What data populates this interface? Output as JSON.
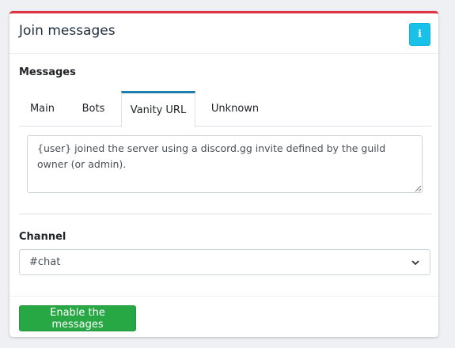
{
  "card": {
    "title": "Join messages",
    "accent_color": "#dc3545",
    "info_button": {
      "label": "i",
      "icon": "info-icon",
      "color": "#17c1e8"
    }
  },
  "messages": {
    "label": "Messages",
    "tabs": [
      {
        "label": "Main",
        "active": false
      },
      {
        "label": "Bots",
        "active": false
      },
      {
        "label": "Vanity URL",
        "active": true
      },
      {
        "label": "Unknown",
        "active": false
      }
    ],
    "text": "{user} joined the server using a discord.gg invite defined by the guild owner (or admin)."
  },
  "channel": {
    "label": "Channel",
    "selected": "#chat",
    "icon": "chevron-down-icon"
  },
  "footer": {
    "enable_label": "Enable the messages",
    "enable_color": "#28a745"
  }
}
